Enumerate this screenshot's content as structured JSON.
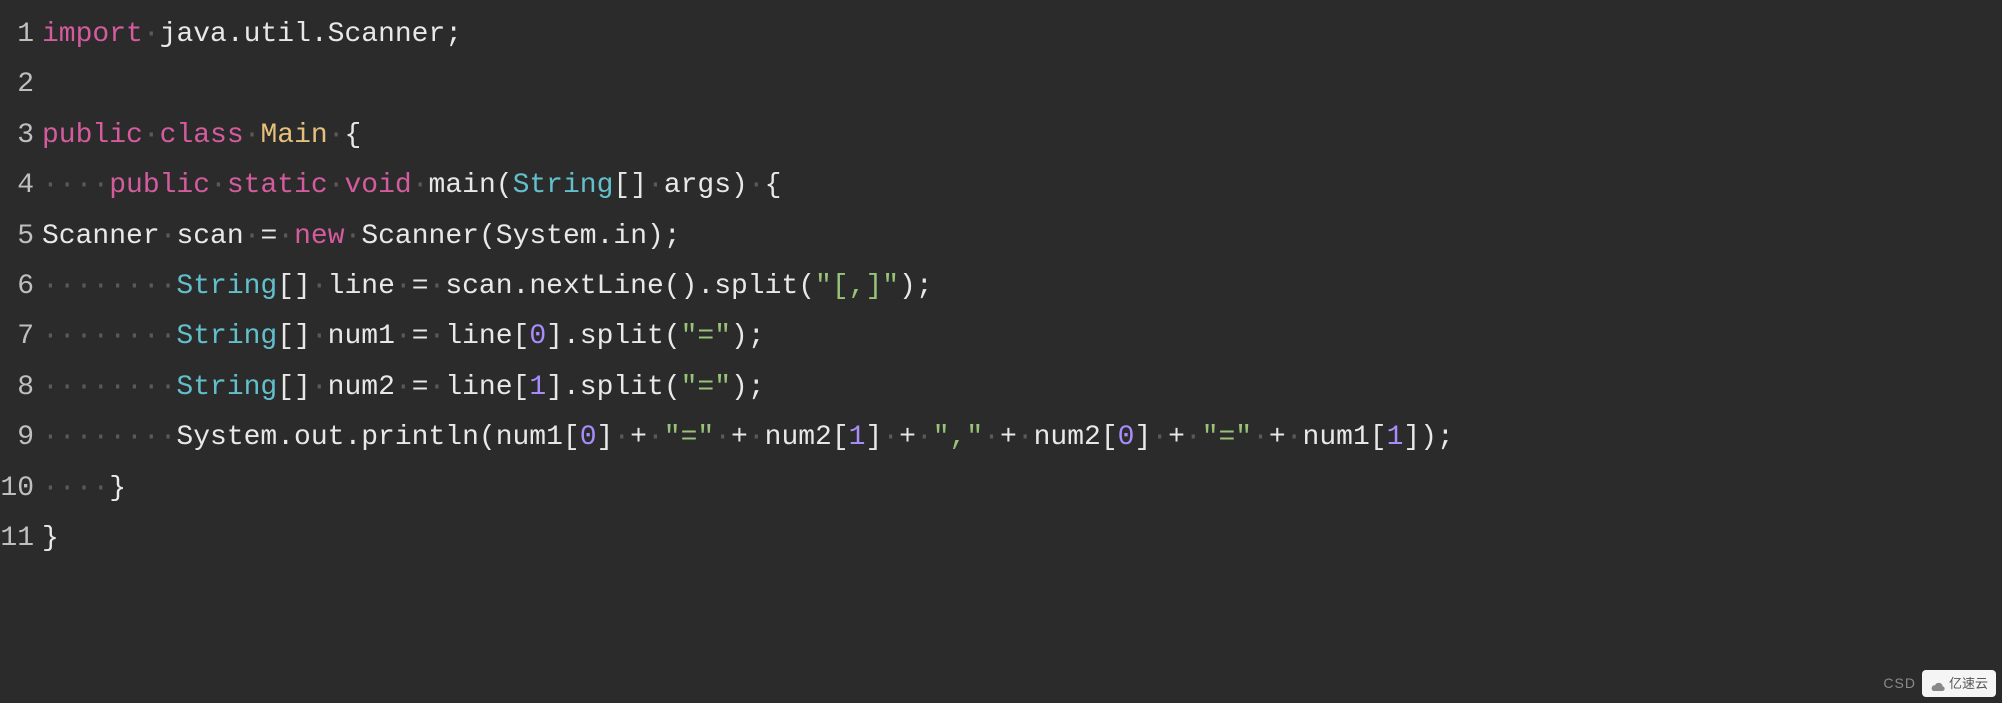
{
  "lines": {
    "n1": "1",
    "n2": "2",
    "n3": "3",
    "n4": "4",
    "n5": "5",
    "n6": "6",
    "n7": "7",
    "n8": "8",
    "n9": "9",
    "n10": "10",
    "n11": "11"
  },
  "tokens": {
    "import": "import",
    "public": "public",
    "class": "class",
    "static": "static",
    "void": "void",
    "new": "new",
    "Main": "Main",
    "String": "String",
    "Scanner": "Scanner",
    "main_method": "main",
    "args": "args",
    "scan": "scan",
    "line": "line",
    "num1": "num1",
    "num2": "num2",
    "java_util_scanner": "java.util.Scanner",
    "system_in": "System.in",
    "system_out_println": "System.out.println",
    "nextLine": ".nextLine()",
    "split": ".split",
    "str_comma_regex": "\"[,]\"",
    "str_eq": "\"=\"",
    "str_comma": "\",\"",
    "idx0": "0",
    "idx1": "1",
    "dot": "·",
    "dots4": "····",
    "dots8": "········",
    "semicolon": ";",
    "lbrace": "{",
    "rbrace": "}",
    "lparen": "(",
    "rparen": ")",
    "lbracket": "[",
    "rbracket": "]",
    "brackets": "[]",
    "eq": "=",
    "plus": "+",
    "sp": " "
  },
  "watermark": {
    "csdn": "CSD",
    "badge": "亿速云"
  }
}
